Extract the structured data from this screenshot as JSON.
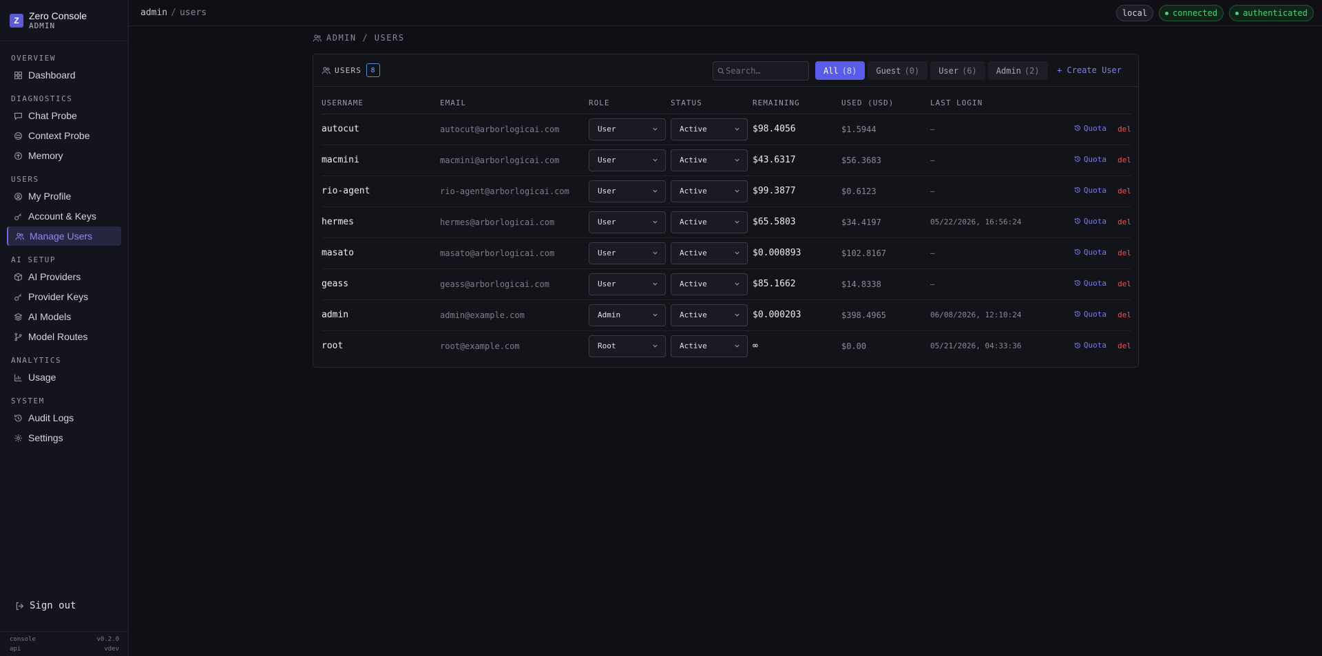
{
  "brand": {
    "logo": "Z",
    "name": "Zero Console",
    "sub": "ADMIN"
  },
  "sidebar": {
    "sections": [
      {
        "title": "OVERVIEW",
        "items": [
          {
            "label": "Dashboard",
            "icon": "grid-icon"
          }
        ]
      },
      {
        "title": "DIAGNOSTICS",
        "items": [
          {
            "label": "Chat Probe",
            "icon": "chat-icon"
          },
          {
            "label": "Context Probe",
            "icon": "layers-icon"
          },
          {
            "label": "Memory",
            "icon": "memory-icon"
          }
        ]
      },
      {
        "title": "USERS",
        "items": [
          {
            "label": "My Profile",
            "icon": "user-circle-icon"
          },
          {
            "label": "Account & Keys",
            "icon": "key-icon"
          },
          {
            "label": "Manage Users",
            "icon": "users-icon",
            "active": true
          }
        ]
      },
      {
        "title": "AI SETUP",
        "items": [
          {
            "label": "AI Providers",
            "icon": "box-icon"
          },
          {
            "label": "Provider Keys",
            "icon": "key-icon"
          },
          {
            "label": "AI Models",
            "icon": "stack-icon"
          },
          {
            "label": "Model Routes",
            "icon": "branch-icon"
          }
        ]
      },
      {
        "title": "ANALYTICS",
        "items": [
          {
            "label": "Usage",
            "icon": "bar-chart-icon"
          }
        ]
      },
      {
        "title": "SYSTEM",
        "items": [
          {
            "label": "Audit Logs",
            "icon": "history-icon"
          },
          {
            "label": "Settings",
            "icon": "gear-icon"
          }
        ]
      }
    ],
    "signout": "Sign out",
    "footer": [
      {
        "k": "console",
        "v": "v0.2.0"
      },
      {
        "k": "api",
        "v": "vdev"
      }
    ]
  },
  "topbar": {
    "crumb_root": "admin",
    "crumb_sep": "/",
    "crumb_current": "users",
    "badges": [
      {
        "label": "local",
        "type": "neutral"
      },
      {
        "label": "connected",
        "type": "ok"
      },
      {
        "label": "authenticated",
        "type": "ok"
      }
    ]
  },
  "page": {
    "heading": "ADMIN / USERS"
  },
  "card": {
    "title": "USERS",
    "count": "8",
    "search_placeholder": "Search…",
    "filters": [
      {
        "label": "All",
        "count": "(8)",
        "active": true
      },
      {
        "label": "Guest",
        "count": "(0)"
      },
      {
        "label": "User",
        "count": "(6)"
      },
      {
        "label": "Admin",
        "count": "(2)"
      }
    ],
    "create_label": "+ Create User"
  },
  "table": {
    "columns": [
      "USERNAME",
      "EMAIL",
      "ROLE",
      "STATUS",
      "REMAINING",
      "USED (USD)",
      "LAST LOGIN",
      "",
      ""
    ],
    "quota_label": "Quota",
    "del_label": "del",
    "rows": [
      {
        "username": "autocut",
        "email": "autocut@arborlogicai.com",
        "role": "User",
        "status": "Active",
        "remaining": "$98.4056",
        "used": "$1.5944",
        "last_login": "—"
      },
      {
        "username": "macmini",
        "email": "macmini@arborlogicai.com",
        "role": "User",
        "status": "Active",
        "remaining": "$43.6317",
        "used": "$56.3683",
        "last_login": "—"
      },
      {
        "username": "rio-agent",
        "email": "rio-agent@arborlogicai.com",
        "role": "User",
        "status": "Active",
        "remaining": "$99.3877",
        "used": "$0.6123",
        "last_login": "—"
      },
      {
        "username": "hermes",
        "email": "hermes@arborlogicai.com",
        "role": "User",
        "status": "Active",
        "remaining": "$65.5803",
        "used": "$34.4197",
        "last_login": "05/22/2026, 16:56:24"
      },
      {
        "username": "masato",
        "email": "masato@arborlogicai.com",
        "role": "User",
        "status": "Active",
        "remaining": "$0.000893",
        "used": "$102.8167",
        "last_login": "—"
      },
      {
        "username": "geass",
        "email": "geass@arborlogicai.com",
        "role": "User",
        "status": "Active",
        "remaining": "$85.1662",
        "used": "$14.8338",
        "last_login": "—"
      },
      {
        "username": "admin",
        "email": "admin@example.com",
        "role": "Admin",
        "status": "Active",
        "remaining": "$0.000203",
        "used": "$398.4965",
        "last_login": "06/08/2026, 12:10:24"
      },
      {
        "username": "root",
        "email": "root@example.com",
        "role": "Root",
        "status": "Active",
        "remaining": "∞",
        "used": "$0.00",
        "last_login": "05/21/2026, 04:33:36"
      }
    ]
  }
}
